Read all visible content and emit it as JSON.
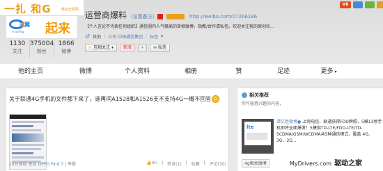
{
  "banner": {
    "logo_text": "一扎 和G",
    "g_text": "G",
    "tagline": "移动无极限"
  },
  "avatar": {
    "logo_text": "天翼",
    "logo_en": "e surfing",
    "word": "起来"
  },
  "stats": [
    {
      "num": "1130",
      "label": "关注"
    },
    {
      "num": "375004",
      "label": "粉丝"
    },
    {
      "num": "1866",
      "label": "微博"
    }
  ],
  "profile": {
    "name": "运营商爆料",
    "name_edit": "(设置备注)",
    "url": "http://weibo.com/07266186",
    "intro": "【个人言论不代表任何组织】通信圈内人气极高的草根微博，指教/合作请私信。欢迎关注我的原创栏...",
    "male_icon": "♂",
    "region": "其他",
    "company": "公司·中国通信集团",
    "tags_label": "标签",
    "tags_arrow": "▾"
  },
  "actions": {
    "follow": "互相关注",
    "follow_arrow": "▾",
    "group": "新浪",
    "message": "私信",
    "more": "▾"
  },
  "corner_icons": [
    "V6",
    "",
    "",
    ""
  ],
  "tabs": [
    {
      "label": "他的主页",
      "width": 70
    },
    {
      "label": "微博",
      "width": 80
    },
    {
      "label": "个人资料",
      "width": 76
    },
    {
      "label": "相册",
      "width": 76
    },
    {
      "label": "赞",
      "width": 64
    },
    {
      "label": "足迹",
      "width": 68
    },
    {
      "label": "更多",
      "width": 66,
      "dropdown": "▾"
    }
  ],
  "post": {
    "text": "关于联通4G手机的文件都下来了，谁再问A1528和A1526支不支持4G一概不回答",
    "time": "16分钟前",
    "from": "来自",
    "source": "OPPO Find 7",
    "report": "举报",
    "like": "(6)",
    "forward": "转发(1)",
    "fav": "收藏",
    "comment": "评论(30)"
  },
  "side": {
    "title": "相关推荐",
    "subtitle": "你可能感兴趣的内容，",
    "rec_author": "谭文胜微博",
    "rec_text": "上网电信、联通获得FDD牌照，5模13频手机即将全面爆发！5模指TD-LTE/FDD-LTE/TD-SCDMA/GSM/WCDMA共5种通信模式，覆盖 4G、3G、2G...",
    "tag": "4g相关微博",
    "thumb_l1": "lte"
  },
  "watermark": {
    "site": "MyDrivers.com",
    "cn": "驱动之家"
  }
}
